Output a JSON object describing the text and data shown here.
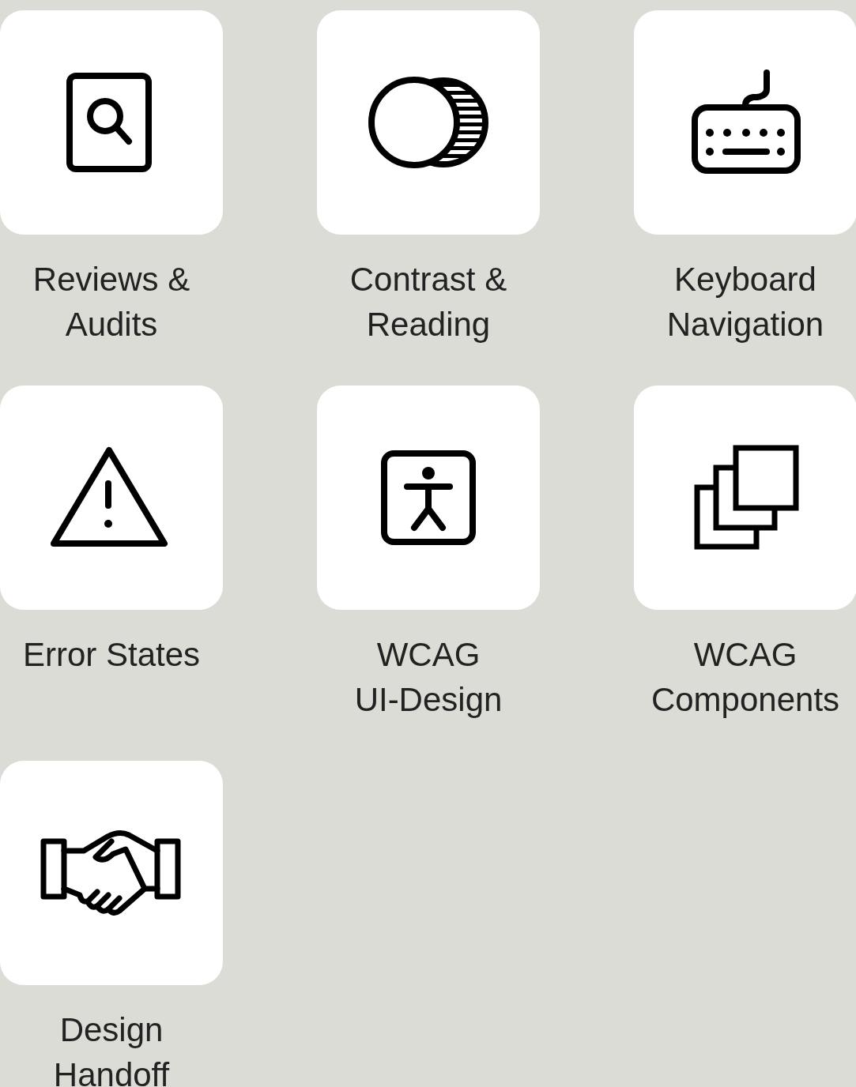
{
  "categories": [
    {
      "label": "Reviews &\nAudits"
    },
    {
      "label": "Contrast &\nReading"
    },
    {
      "label": "Keyboard\nNavigation"
    },
    {
      "label": "Error States"
    },
    {
      "label": "WCAG\nUI-Design"
    },
    {
      "label": "WCAG\nComponents"
    },
    {
      "label": "Design\nHandoff"
    }
  ]
}
